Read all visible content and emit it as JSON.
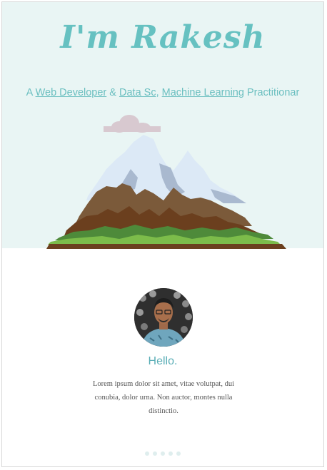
{
  "hero": {
    "title": "I'm Rakesh",
    "subtitle": {
      "prefix": "A ",
      "link1": "Web Developer",
      "sep1": " & ",
      "link2": "Data Sc",
      "sep2": ", ",
      "link3": "Machine Learning",
      "suffix": " Practitionar"
    },
    "background_color": "#e9f5f4",
    "accent_color": "#66c1c1"
  },
  "profile": {
    "avatar_icon": "profile-photo",
    "greeting": "Hello.",
    "bio": "Lorem ipsum dolor sit amet, vitae volutpat, dui conubia, dolor urna. Non auctor, montes nulla distinctio."
  },
  "carousel": {
    "dots": [
      "dot-1",
      "dot-2",
      "dot-3",
      "dot-4",
      "dot-5"
    ]
  }
}
